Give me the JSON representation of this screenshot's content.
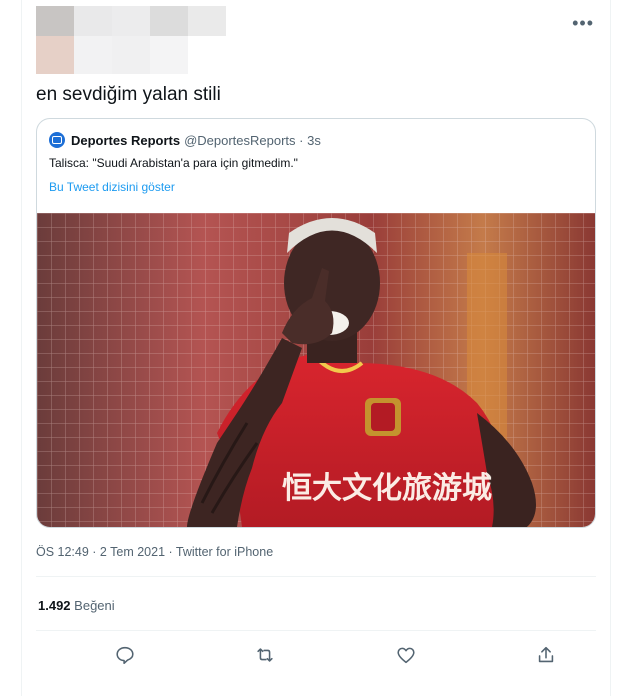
{
  "tweet": {
    "text": "en sevdiğim yalan stili",
    "more_glyph": "•••",
    "timestamp": "ÖS 12:49 · 2 Tem 2021 · Twitter for iPhone",
    "likes_count": "1.492",
    "likes_label": "Beğeni"
  },
  "quoted": {
    "name": "Deportes Reports",
    "handle": "@DeportesReports · 3s",
    "text": "Talisca: \"Suudi Arabistan'a para için gitmedim.\"",
    "show_thread": "Bu Tweet dizisini göster",
    "jersey_text": "恒大文化旅游城"
  },
  "icons": {
    "reply": "reply-icon",
    "retweet": "retweet-icon",
    "like": "like-icon",
    "share": "share-icon"
  },
  "colors": {
    "link": "#1d9bf0",
    "secondary": "#536471",
    "border": "#cfd9de",
    "jersey_red": "#c8212a"
  }
}
